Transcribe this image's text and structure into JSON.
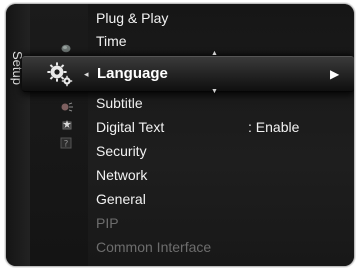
{
  "sidebar": {
    "title": "Setup"
  },
  "menu": {
    "items_above": [
      {
        "label": "Plug & Play"
      },
      {
        "label": "Time"
      }
    ],
    "selected": {
      "label": "Language",
      "left_arrow": "◂",
      "right_arrow": "▶"
    },
    "items_below": [
      {
        "label": "Subtitle",
        "value": ""
      },
      {
        "label": "Digital Text",
        "value": ": Enable"
      },
      {
        "label": "Security",
        "value": ""
      },
      {
        "label": "Network",
        "value": ""
      },
      {
        "label": "General",
        "value": ""
      },
      {
        "label": "PIP",
        "value": "",
        "disabled": true
      },
      {
        "label": "Common Interface",
        "value": "",
        "disabled": true
      }
    ]
  },
  "icons": {
    "selected_category": "gear-icon",
    "categories": [
      "picture-icon",
      "gear-icon",
      "sound-icon",
      "channel-icon",
      "help-icon"
    ]
  },
  "colors": {
    "panel": "#1b1b1b",
    "text": "#f2f2f2",
    "disabled_text": "#6d6d6d"
  }
}
